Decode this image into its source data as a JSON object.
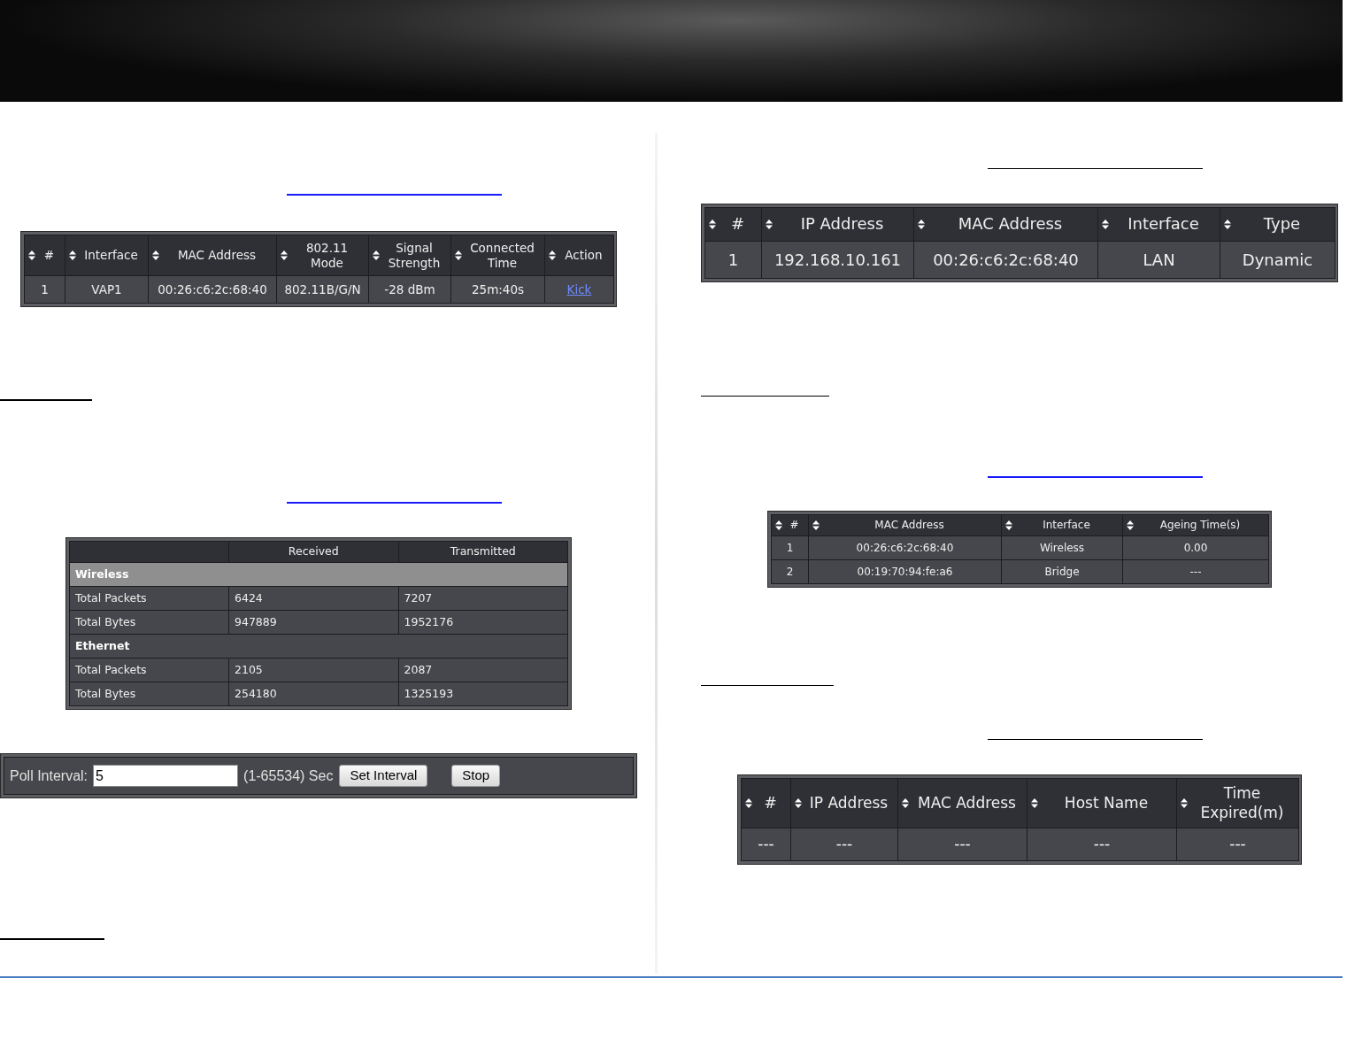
{
  "wireless_clients": {
    "columns": [
      "#",
      "Interface",
      "MAC Address",
      "802.11 Mode",
      "Signal Strength",
      "Connected Time",
      "Action"
    ],
    "rows": [
      [
        {
          "text": "1",
          "kind": "text"
        },
        {
          "text": "VAP1",
          "kind": "text"
        },
        {
          "text": "00:26:c6:2c:68:40",
          "kind": "text"
        },
        {
          "text": "802.11B/G/N",
          "kind": "text"
        },
        {
          "text": "-28 dBm",
          "kind": "text"
        },
        {
          "text": "25m:40s",
          "kind": "text"
        },
        {
          "text": "Kick",
          "kind": "link"
        }
      ]
    ]
  },
  "statistics": {
    "columns": [
      "Received",
      "Transmitted"
    ],
    "sections": [
      {
        "title": "Wireless",
        "selected": true,
        "rows": [
          {
            "label": "Total Packets",
            "received": "6424",
            "transmitted": "7207"
          },
          {
            "label": "Total Bytes",
            "received": "947889",
            "transmitted": "1952176"
          }
        ]
      },
      {
        "title": "Ethernet",
        "selected": false,
        "rows": [
          {
            "label": "Total Packets",
            "received": "2105",
            "transmitted": "2087"
          },
          {
            "label": "Total Bytes",
            "received": "254180",
            "transmitted": "1325193"
          }
        ]
      }
    ]
  },
  "poll": {
    "label": "Poll Interval:",
    "value": "5",
    "range": "(1-65534) Sec",
    "buttons": [
      "Set Interval",
      "Stop"
    ]
  },
  "arp_table": {
    "columns": [
      "#",
      "IP Address",
      "MAC Address",
      "Interface",
      "Type"
    ],
    "rows": [
      [
        {
          "text": "1",
          "kind": "text"
        },
        {
          "text": "192.168.10.161",
          "kind": "text"
        },
        {
          "text": "00:26:c6:2c:68:40",
          "kind": "text"
        },
        {
          "text": "LAN",
          "kind": "text"
        },
        {
          "text": "Dynamic",
          "kind": "text"
        }
      ]
    ]
  },
  "bridge_table": {
    "columns": [
      "#",
      "MAC Address",
      "Interface",
      "Ageing Time(s)"
    ],
    "rows": [
      [
        {
          "text": "1",
          "kind": "text"
        },
        {
          "text": "00:26:c6:2c:68:40",
          "kind": "text"
        },
        {
          "text": "Wireless",
          "kind": "text"
        },
        {
          "text": "0.00",
          "kind": "text"
        }
      ],
      [
        {
          "text": "2",
          "kind": "text"
        },
        {
          "text": "00:19:70:94:fe:a6",
          "kind": "text"
        },
        {
          "text": "Bridge",
          "kind": "text"
        },
        {
          "text": "---",
          "kind": "text"
        }
      ]
    ]
  },
  "dhcp_clients": {
    "columns": [
      "#",
      "IP Address",
      "MAC Address",
      "Host Name",
      "Time Expired(m)"
    ],
    "rows": [
      [
        {
          "text": "---",
          "kind": "text"
        },
        {
          "text": "---",
          "kind": "text"
        },
        {
          "text": "---",
          "kind": "text"
        },
        {
          "text": "---",
          "kind": "text"
        },
        {
          "text": "---",
          "kind": "text"
        }
      ]
    ]
  }
}
